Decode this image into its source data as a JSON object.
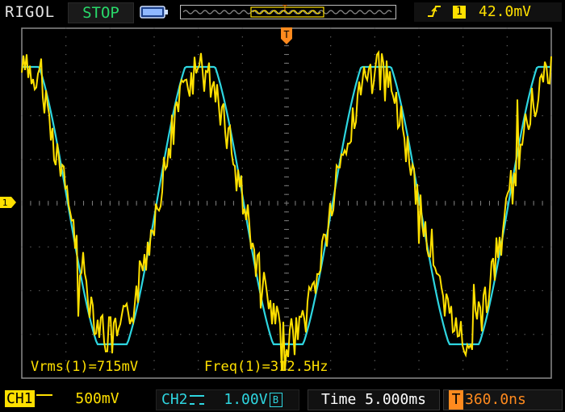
{
  "header": {
    "brand": "RIGOL",
    "run_state": "STOP",
    "trigger": {
      "edge_icon": "rising-edge-icon",
      "source": "1",
      "level": "42.0mV",
      "marker": "T"
    }
  },
  "measurements": {
    "vrms": "Vrms(1)=715mV",
    "freq": "Freq(1)=312.5Hz"
  },
  "footer": {
    "ch1": {
      "label": "CH1",
      "coupling_icon": "dc-coupling-icon",
      "scale": "500mV"
    },
    "ch2": {
      "label": "CH2",
      "coupling_icon": "dc-coupling-icon",
      "scale": "1.00V",
      "bw_limit": "B"
    },
    "timebase": "Time 5.000ms",
    "trigger_offset": "360.0ns"
  },
  "colors": {
    "ch1": "#ffe000",
    "ch2": "#2ed6e0",
    "trigger": "#ff8a1e",
    "grid": "#5a5a5a"
  }
}
